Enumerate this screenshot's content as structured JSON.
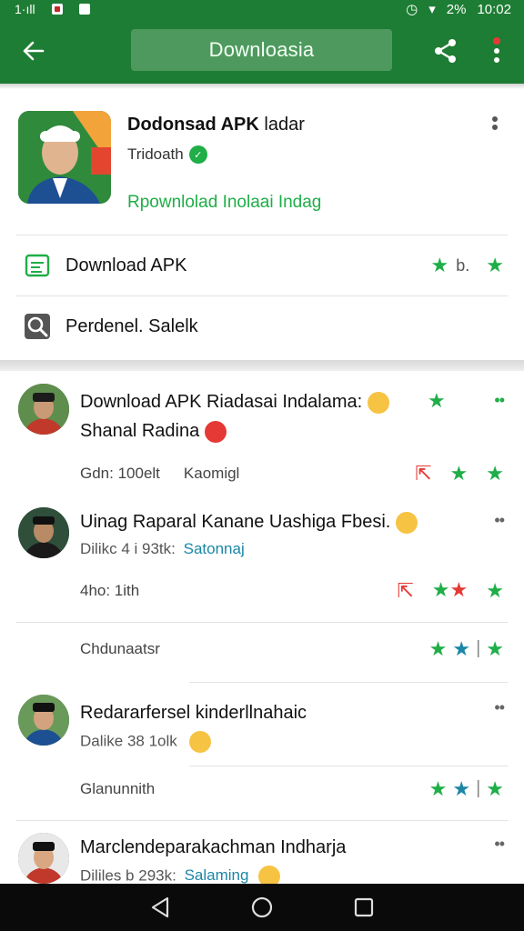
{
  "status_bar": {
    "time": "10:02",
    "battery": "2%"
  },
  "app_bar": {
    "title": "Downloasia"
  },
  "app": {
    "title": "Dodonsad APK",
    "title_extra": "ladar",
    "subtitle": "Tridoath",
    "link": "Rpownlolad Inolaai Indag"
  },
  "rows": [
    {
      "label": "Download APK",
      "suffix": "b."
    },
    {
      "label": "Perdenel. Salelk"
    }
  ],
  "posts": [
    {
      "title_line1": "Download APK Riadasai Indalama:",
      "title_line2": "Shanal Radina",
      "meta_left": "Gdn: 100elt",
      "meta_right": "Kaomigl"
    },
    {
      "title_line1": "Uinag Raparal Kanane Uashiga Fbesi.",
      "meta": "Dilikc 4 i 93tk:",
      "meta_tag": "Satonnaj",
      "action": "4ho: 1ith",
      "action2": "Chdunaatsr"
    },
    {
      "title_line1": "Redararfersel kinderllnahaic",
      "meta": "Dalike 38 1olk",
      "action": "Glanunnith"
    },
    {
      "title_line1": "Marclendeparakachman Indharja",
      "meta": "Dililes b 293k:",
      "meta_tag": "Salaming"
    }
  ]
}
